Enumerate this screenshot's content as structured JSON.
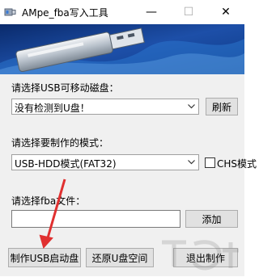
{
  "window": {
    "title": "AMpe_fba写入工具",
    "minimize_glyph": "—",
    "maximize_glyph": "☐",
    "close_glyph": "✕"
  },
  "disk": {
    "label": "请选择USB可移动磁盘：",
    "selected": "没有检测到U盘！",
    "refresh_label": "刷新"
  },
  "mode": {
    "label": "请选择要制作的模式：",
    "selected": "USB-HDD模式(FAT32)",
    "chs_label": "CHS模式",
    "chs_checked": false
  },
  "fba": {
    "label": "请选择fba文件：",
    "path_value": "",
    "add_label": "添加"
  },
  "actions": {
    "make_label": "制作USB启动盘",
    "restore_label": "还原U盘空间",
    "exit_label": "退出制作"
  },
  "colors": {
    "annotation_arrow": "#e03030",
    "banner_dark": "#0a2a6b",
    "banner_light": "#2f7fd6"
  }
}
